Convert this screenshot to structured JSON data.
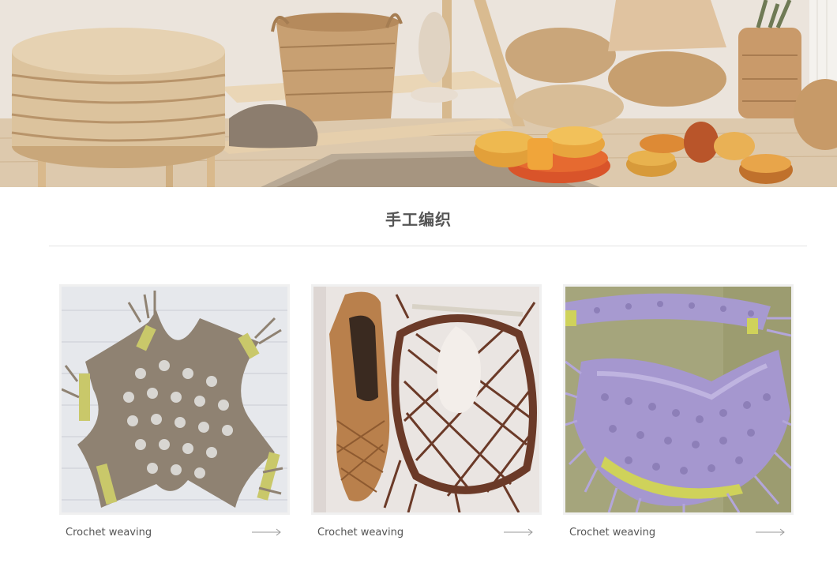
{
  "banner": {
    "image": "handwoven-baskets-and-ottomans-banner",
    "colors": {
      "wood": "#e8d3b5",
      "straw": "#d6b88c",
      "orange": "#e5a23a",
      "red": "#d9542a"
    }
  },
  "section": {
    "title": "手工编织"
  },
  "products": [
    {
      "caption": "Crochet weaving",
      "image": "woven-cross-shape-taupe-cord",
      "arrow": "right-arrow-icon"
    },
    {
      "caption": "Crochet weaving",
      "image": "woven-shoe-and-brown-net-collar",
      "arrow": "right-arrow-icon"
    },
    {
      "caption": "Crochet weaving",
      "image": "purple-macrame-bib-collar",
      "arrow": "right-arrow-icon"
    }
  ]
}
